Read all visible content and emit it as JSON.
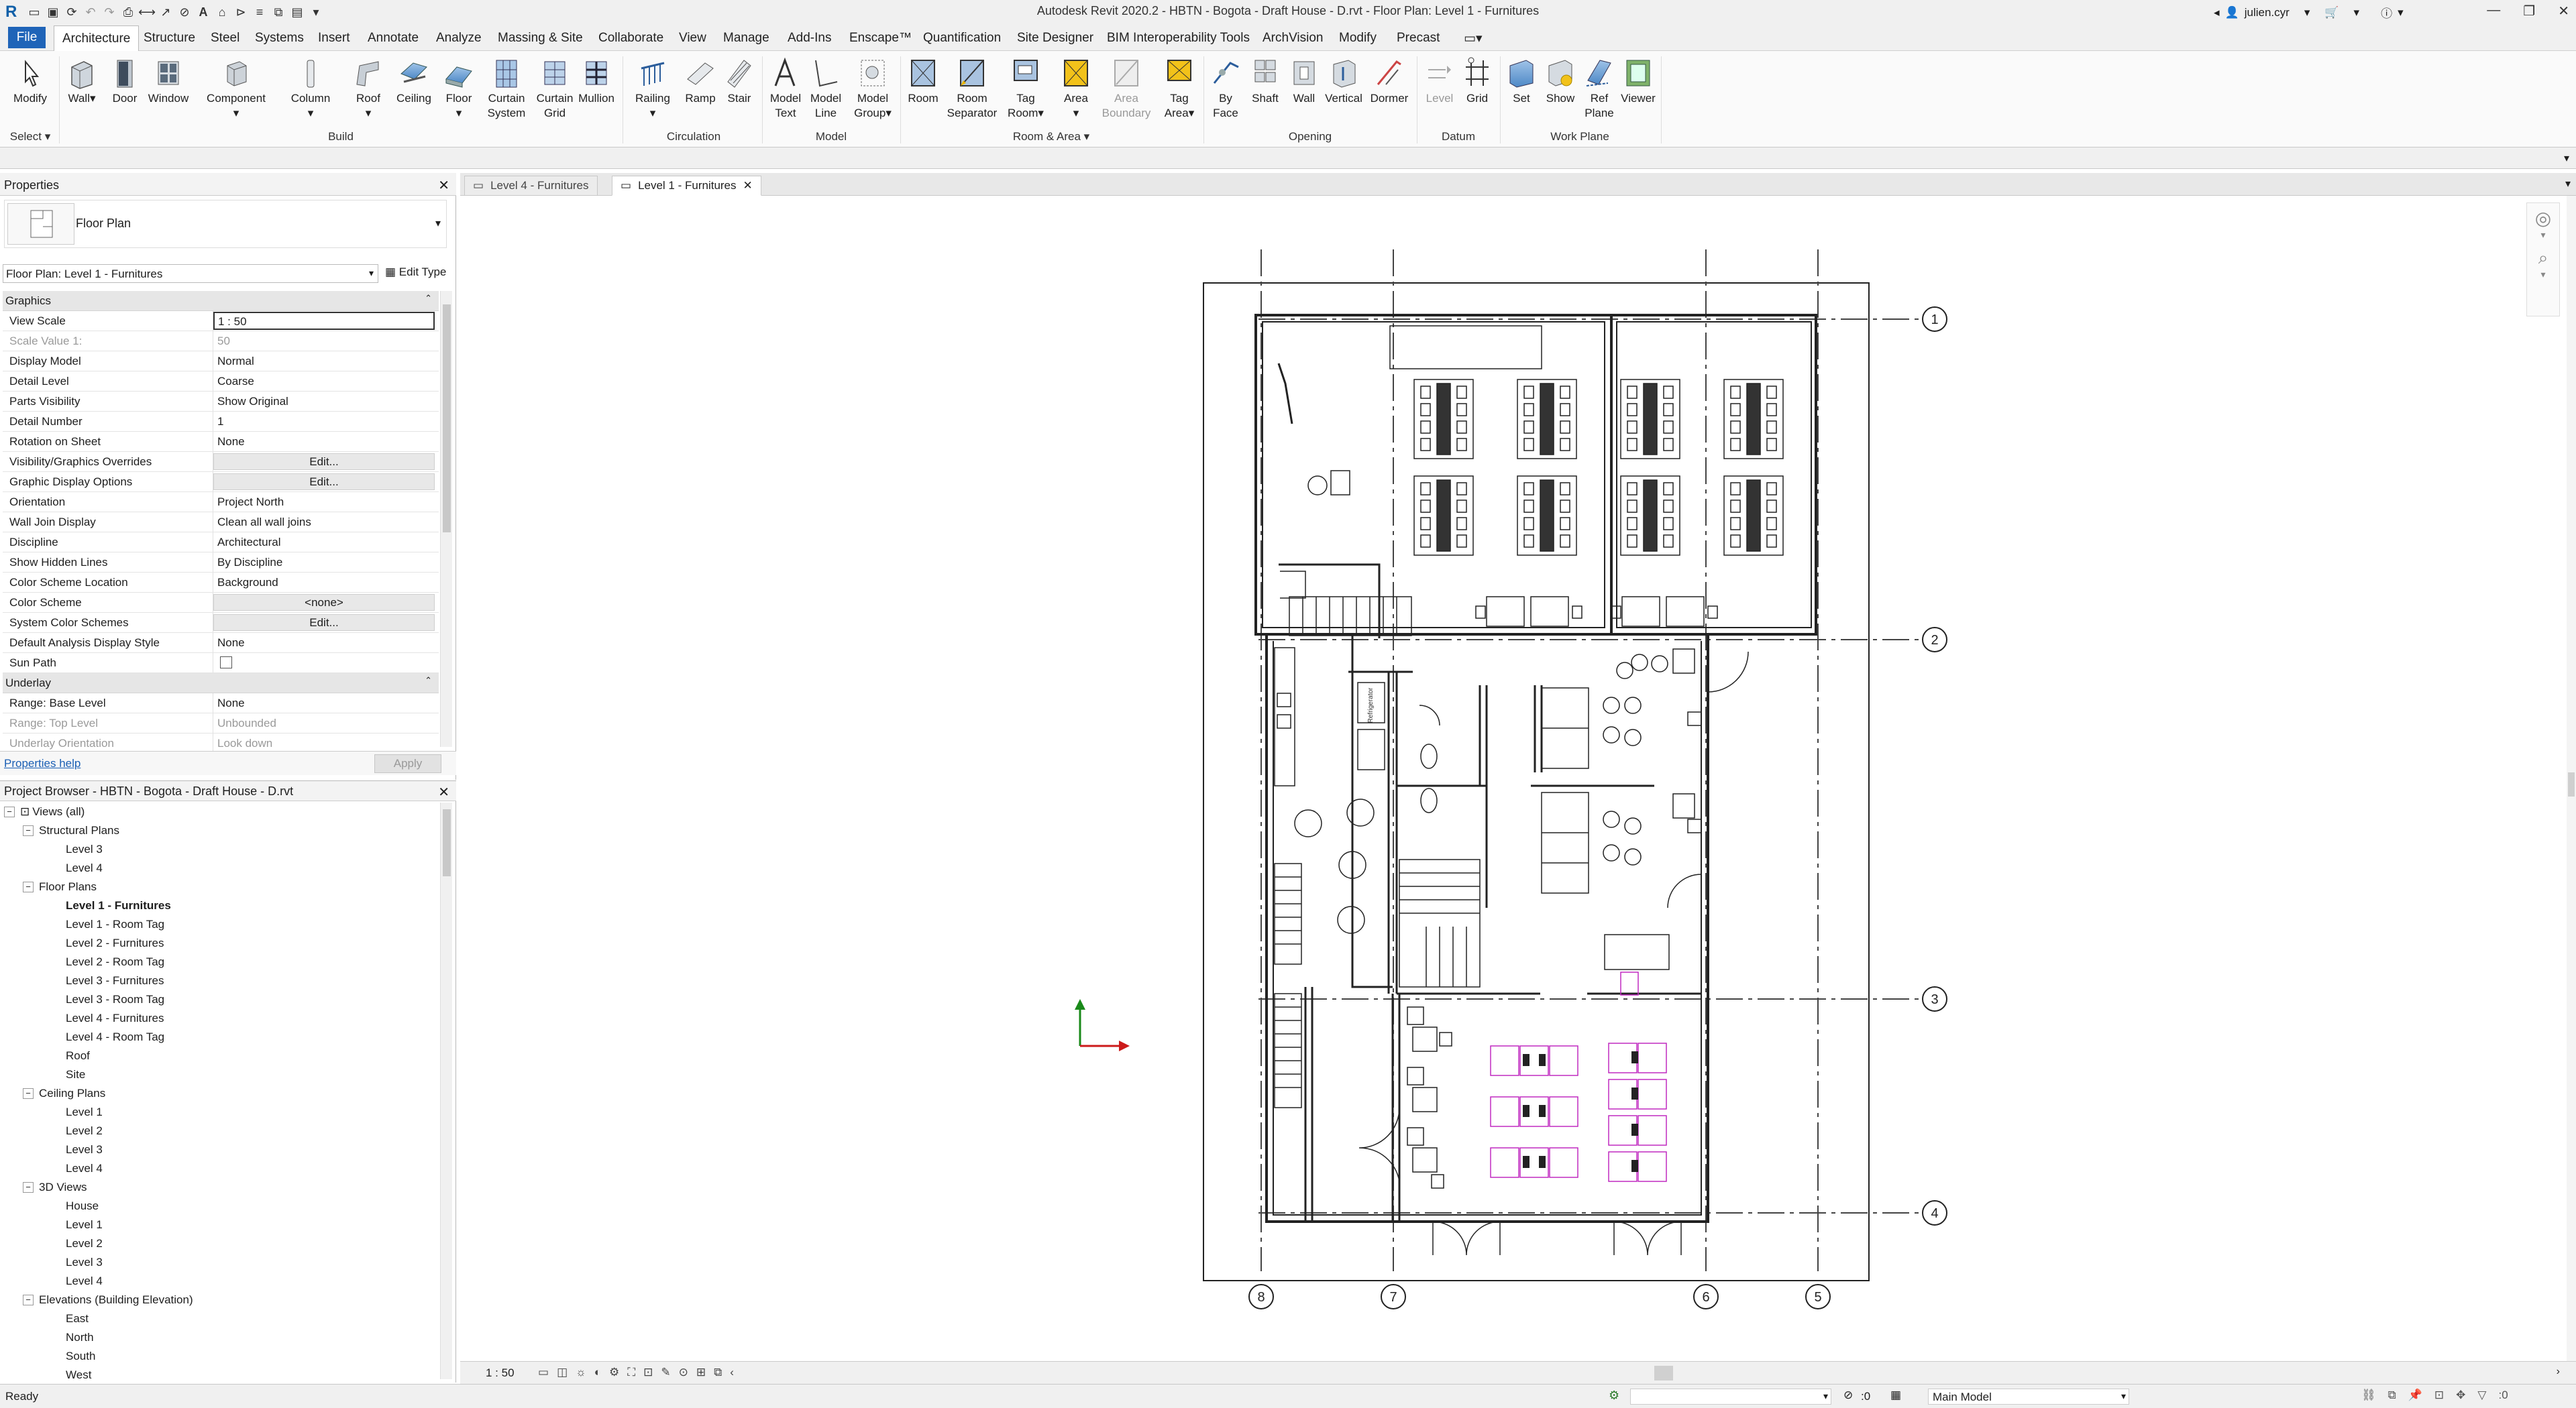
{
  "app": {
    "title": "Autodesk Revit 2020.2 - HBTN - Bogota - Draft House - D.rvt - Floor Plan: Level 1 - Furnitures",
    "user": "julien.cyr"
  },
  "menu_tabs": [
    "File",
    "Architecture",
    "Structure",
    "Steel",
    "Systems",
    "Insert",
    "Annotate",
    "Analyze",
    "Massing & Site",
    "Collaborate",
    "View",
    "Manage",
    "Add-Ins",
    "Enscape™",
    "Quantification",
    "Site Designer",
    "BIM Interoperability Tools",
    "ArchVision",
    "Modify",
    "Precast"
  ],
  "ribbon": {
    "select_label": "Select",
    "buttons": {
      "modify": "Modify",
      "wall": "Wall",
      "door": "Door",
      "window": "Window",
      "component": "Component",
      "column": "Column",
      "roof": "Roof",
      "ceiling": "Ceiling",
      "floor": "Floor",
      "curtain_system_1": "Curtain",
      "curtain_system_2": "System",
      "curtain_grid_1": "Curtain",
      "curtain_grid_2": "Grid",
      "mullion": "Mullion",
      "railing": "Railing",
      "ramp": "Ramp",
      "stair": "Stair",
      "model_text_1": "Model",
      "model_text_2": "Text",
      "model_line_1": "Model",
      "model_line_2": "Line",
      "model_group_1": "Model",
      "model_group_2": "Group",
      "room": "Room",
      "room_sep_1": "Room",
      "room_sep_2": "Separator",
      "tag_room_1": "Tag",
      "tag_room_2": "Room",
      "area": "Area",
      "area_boundary_1": "Area",
      "area_boundary_2": "Boundary",
      "tag_area_1": "Tag",
      "tag_area_2": "Area",
      "by_face_1": "By",
      "by_face_2": "Face",
      "shaft": "Shaft",
      "op_wall": "Wall",
      "vertical": "Vertical",
      "dormer": "Dormer",
      "level": "Level",
      "grid": "Grid",
      "set": "Set",
      "show": "Show",
      "ref_plane_1": "Ref",
      "ref_plane_2": "Plane",
      "viewer": "Viewer"
    },
    "panels": {
      "build": "Build",
      "circulation": "Circulation",
      "model": "Model",
      "room_area": "Room & Area",
      "opening": "Opening",
      "datum": "Datum",
      "work_plane": "Work Plane"
    }
  },
  "properties": {
    "header": "Properties",
    "type_name": "Floor Plan",
    "instance": "Floor Plan: Level 1 - Furnitures",
    "edit_type": "Edit Type",
    "cat_graphics": "Graphics",
    "rows": [
      {
        "k": "View Scale",
        "v": "1 : 50"
      },
      {
        "k": "Scale Value    1:",
        "v": "50"
      },
      {
        "k": "Display Model",
        "v": "Normal"
      },
      {
        "k": "Detail Level",
        "v": "Coarse"
      },
      {
        "k": "Parts Visibility",
        "v": "Show Original"
      },
      {
        "k": "Detail Number",
        "v": "1"
      },
      {
        "k": "Rotation on Sheet",
        "v": "None"
      },
      {
        "k": "Visibility/Graphics Overrides",
        "v": "Edit..."
      },
      {
        "k": "Graphic Display Options",
        "v": "Edit..."
      },
      {
        "k": "Orientation",
        "v": "Project North"
      },
      {
        "k": "Wall Join Display",
        "v": "Clean all wall joins"
      },
      {
        "k": "Discipline",
        "v": "Architectural"
      },
      {
        "k": "Show Hidden Lines",
        "v": "By Discipline"
      },
      {
        "k": "Color Scheme Location",
        "v": "Background"
      },
      {
        "k": "Color Scheme",
        "v": "<none>"
      },
      {
        "k": "System Color Schemes",
        "v": "Edit..."
      },
      {
        "k": "Default Analysis Display Style",
        "v": "None"
      },
      {
        "k": "Sun Path",
        "v": ""
      }
    ],
    "cat_underlay": "Underlay",
    "underlay_rows": [
      {
        "k": "Range: Base Level",
        "v": "None"
      },
      {
        "k": "Range: Top Level",
        "v": "Unbounded"
      },
      {
        "k": "Underlay Orientation",
        "v": "Look down"
      }
    ],
    "help": "Properties help",
    "apply": "Apply"
  },
  "browser": {
    "header": "Project Browser - HBTN - Bogota - Draft House - D.rvt",
    "views_all": "Views (all)",
    "structural": "Structural Plans",
    "structural_items": [
      "Level 3",
      "Level 4"
    ],
    "floor": "Floor Plans",
    "floor_items": [
      "Level 1 - Furnitures",
      "Level 1 - Room Tag",
      "Level 2 - Furnitures",
      "Level 2 - Room Tag",
      "Level 3 - Furnitures",
      "Level 3 - Room Tag",
      "Level 4 - Furnitures",
      "Level 4 - Room Tag",
      "Roof",
      "Site"
    ],
    "ceiling": "Ceiling Plans",
    "ceiling_items": [
      "Level 1",
      "Level 2",
      "Level 3",
      "Level 4"
    ],
    "views3d": "3D Views",
    "views3d_items": [
      "House",
      "Level 1",
      "Level 2",
      "Level 3",
      "Level 4"
    ],
    "elevations": "Elevations (Building Elevation)",
    "elevation_items": [
      "East",
      "North",
      "South",
      "West"
    ]
  },
  "view_tabs": [
    "Level 4 - Furnitures",
    "Level 1 - Furnitures"
  ],
  "drawing": {
    "grid_labels": [
      "1",
      "2",
      "3",
      "4",
      "8",
      "7",
      "6",
      "5"
    ],
    "fridge_label": "Refrigerator"
  },
  "view_control": {
    "scale": "1 : 50"
  },
  "status": {
    "text": "Ready",
    "zero": ":0",
    "model": "Main Model"
  }
}
